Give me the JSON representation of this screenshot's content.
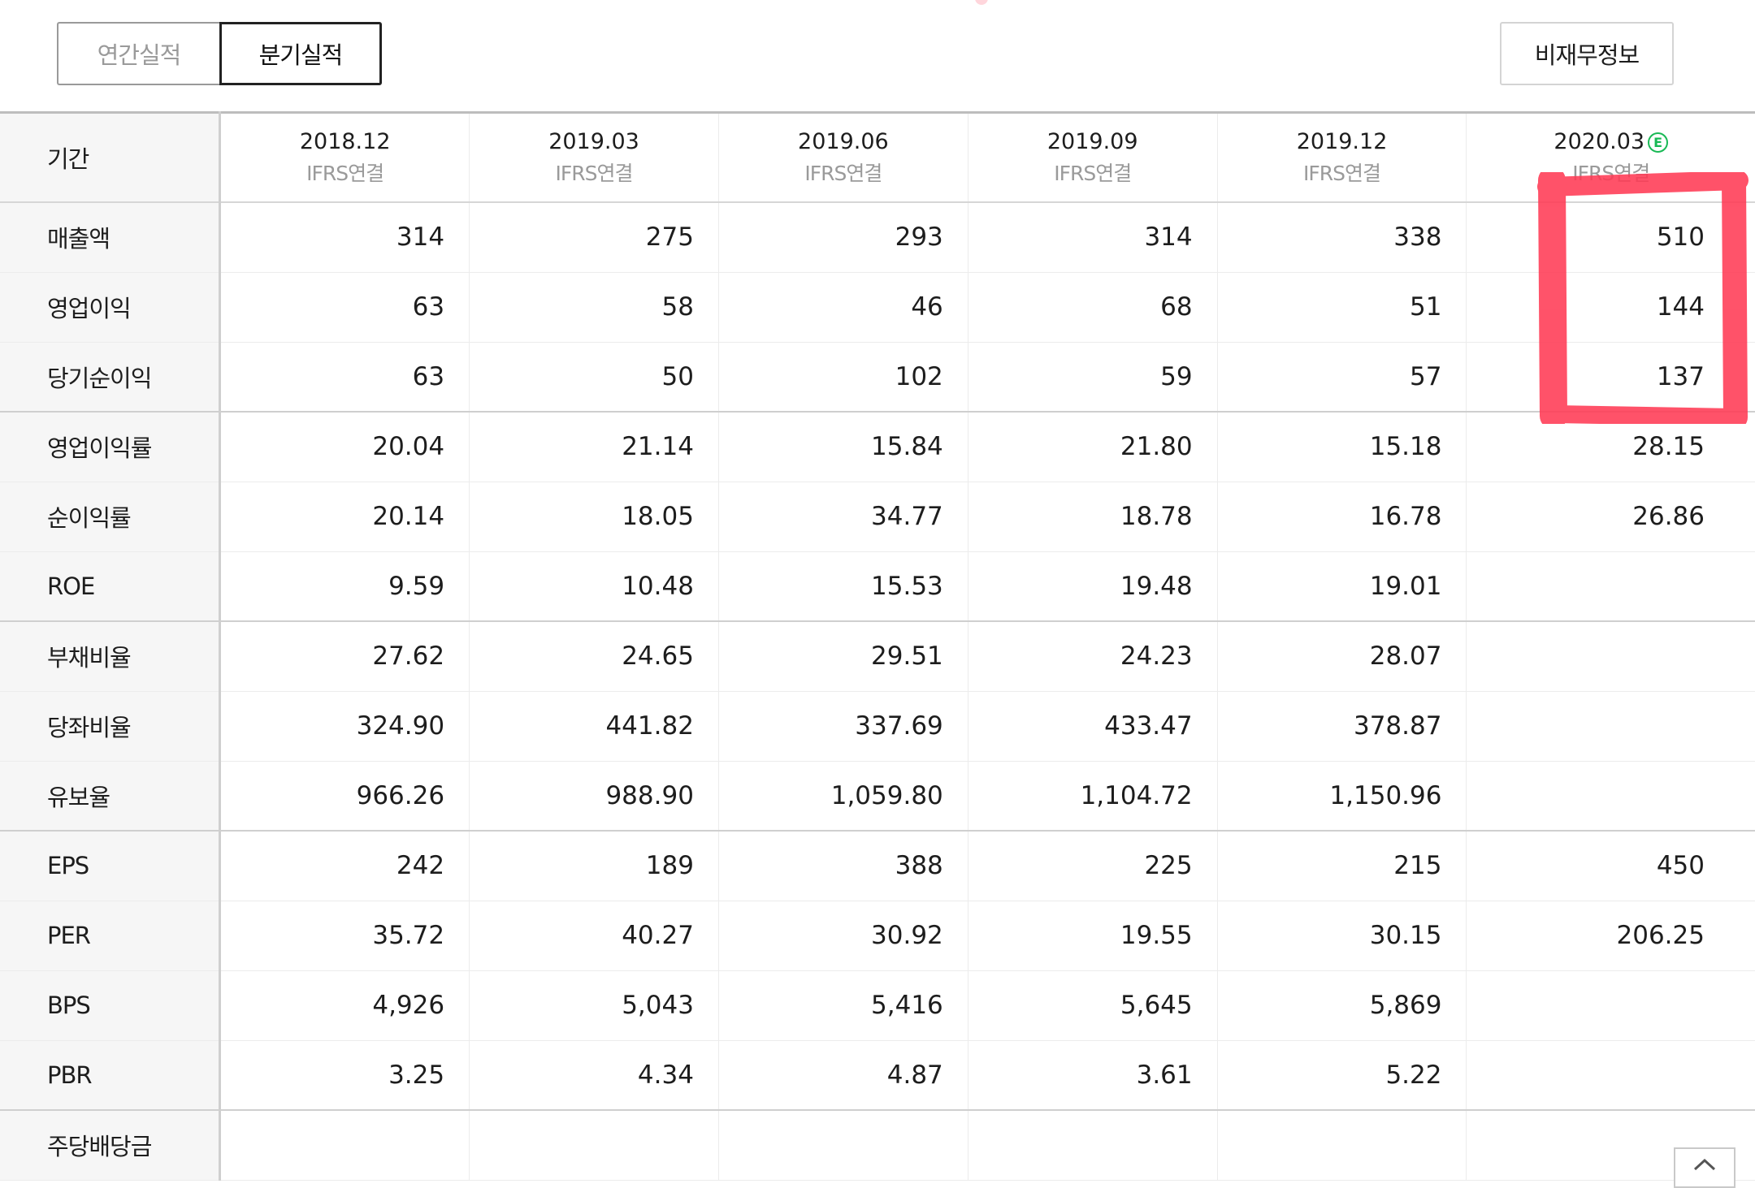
{
  "tabs": {
    "annual": "연간실적",
    "quarterly": "분기실적",
    "selected": "quarterly"
  },
  "nonfinancial_button": "비재무정보",
  "table": {
    "period_header": "기간",
    "periods": [
      {
        "date": "2018.12",
        "accounting": "IFRS연결",
        "estimate": false
      },
      {
        "date": "2019.03",
        "accounting": "IFRS연결",
        "estimate": false
      },
      {
        "date": "2019.06",
        "accounting": "IFRS연결",
        "estimate": false
      },
      {
        "date": "2019.09",
        "accounting": "IFRS연결",
        "estimate": false
      },
      {
        "date": "2019.12",
        "accounting": "IFRS연결",
        "estimate": false
      },
      {
        "date": "2020.03",
        "accounting": "IFRS연결",
        "estimate": true,
        "estimate_mark": "E"
      }
    ],
    "rows": [
      {
        "label": "매출액",
        "values": [
          "314",
          "275",
          "293",
          "314",
          "338",
          "510"
        ]
      },
      {
        "label": "영업이익",
        "values": [
          "63",
          "58",
          "46",
          "68",
          "51",
          "144"
        ]
      },
      {
        "label": "당기순이익",
        "values": [
          "63",
          "50",
          "102",
          "59",
          "57",
          "137"
        ]
      },
      {
        "label": "영업이익률",
        "values": [
          "20.04",
          "21.14",
          "15.84",
          "21.80",
          "15.18",
          "28.15"
        ]
      },
      {
        "label": "순이익률",
        "values": [
          "20.14",
          "18.05",
          "34.77",
          "18.78",
          "16.78",
          "26.86"
        ]
      },
      {
        "label": "ROE",
        "values": [
          "9.59",
          "10.48",
          "15.53",
          "19.48",
          "19.01",
          ""
        ]
      },
      {
        "label": "부채비율",
        "values": [
          "27.62",
          "24.65",
          "29.51",
          "24.23",
          "28.07",
          ""
        ]
      },
      {
        "label": "당좌비율",
        "values": [
          "324.90",
          "441.82",
          "337.69",
          "433.47",
          "378.87",
          ""
        ]
      },
      {
        "label": "유보율",
        "values": [
          "966.26",
          "988.90",
          "1,059.80",
          "1,104.72",
          "1,150.96",
          ""
        ]
      },
      {
        "label": "EPS",
        "values": [
          "242",
          "189",
          "388",
          "225",
          "215",
          "450"
        ]
      },
      {
        "label": "PER",
        "values": [
          "35.72",
          "40.27",
          "30.92",
          "19.55",
          "30.15",
          "206.25"
        ]
      },
      {
        "label": "BPS",
        "values": [
          "4,926",
          "5,043",
          "5,416",
          "5,645",
          "5,869",
          ""
        ]
      },
      {
        "label": "PBR",
        "values": [
          "3.25",
          "4.34",
          "4.87",
          "3.61",
          "5.22",
          ""
        ]
      },
      {
        "label": "주당배당금",
        "values": [
          "",
          "",
          "",
          "",
          "",
          ""
        ]
      }
    ]
  },
  "colors": {
    "estimate_badge": "#19b955",
    "highlight_marker": "#ff3b55",
    "label_background": "#f6f6f6",
    "inactive_tab_text": "#9a9a9a"
  },
  "icons": {
    "scroll_top": "chevron-up-icon",
    "estimate": "estimate-badge-icon"
  }
}
